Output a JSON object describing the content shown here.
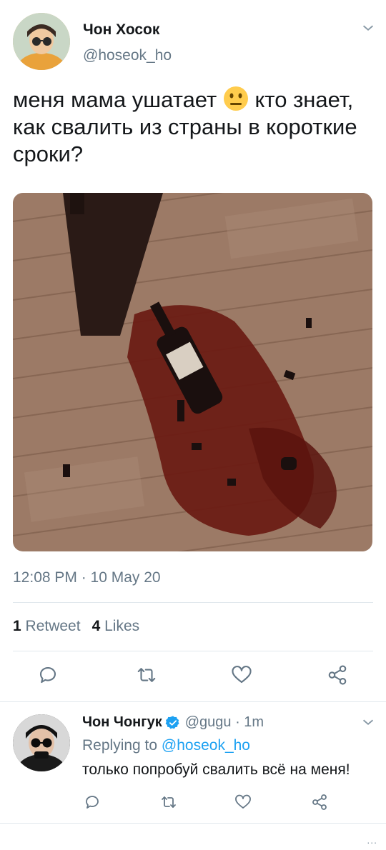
{
  "tweet": {
    "author_name": "Чон Хосок",
    "handle": "@hoseok_ho",
    "text_before_emoji": "меня мама ушатает ",
    "text_after_emoji": " кто знает, как свалить из страны в короткие сроки?",
    "emoji": "neutral-face-emoji",
    "timestamp": "12:08 PM · 10 May 20",
    "retweet_count": "1",
    "retweet_label": "Retweet",
    "likes_count": "4",
    "likes_label": "Likes"
  },
  "reply": {
    "author_name": "Чон Чонгук",
    "handle_time": "@gugu · 1m",
    "replying_label": "Replying to",
    "replying_mention": "@hoseok_ho",
    "text": "только попробуй свалить всё на меня!",
    "more": "..."
  },
  "colors": {
    "accent": "#1da1f2",
    "secondary_text": "#657786",
    "divider": "#e1e8ed"
  }
}
